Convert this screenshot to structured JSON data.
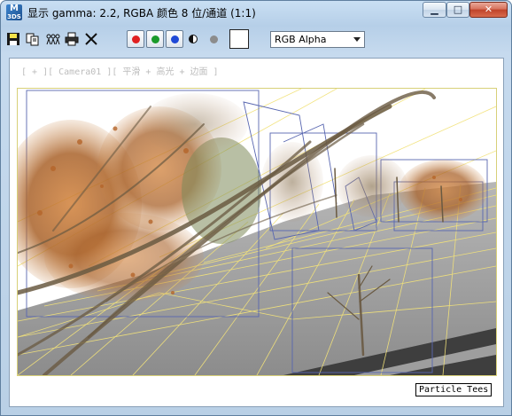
{
  "window": {
    "title": "显示 gamma: 2.2, RGBA 颜色 8 位/通道 (1:1)",
    "app_icon_line1": "M",
    "app_icon_line2": "3DS",
    "minimize_glyph": "▁",
    "maximize_glyph": "□",
    "close_glyph": "✕"
  },
  "toolbar": {
    "icons": [
      "save-icon",
      "copy-icon",
      "clone-icon",
      "print-icon",
      "clear-icon"
    ],
    "save_glyph": "■",
    "copy_glyph": "⧉",
    "clone_glyph": "⁂",
    "print_glyph": "⎙",
    "clear_glyph": "✕",
    "channels": [
      {
        "name": "red",
        "color": "#e02020"
      },
      {
        "name": "green",
        "color": "#1a9a2a"
      },
      {
        "name": "blue",
        "color": "#1f49d6"
      }
    ],
    "channel_display": "RGB Alpha"
  },
  "viewport": {
    "label": "[ + ][ Camera01 ][ 平滑 + 高光 + 边面 ]",
    "tag": "Particle Tees",
    "colors": {
      "sky": "#ffffff",
      "ground": "#a3a3a3",
      "wire_yellow": "#f2e27a",
      "wire_blue": "#5866b0",
      "foliage": "#c8762e"
    }
  }
}
